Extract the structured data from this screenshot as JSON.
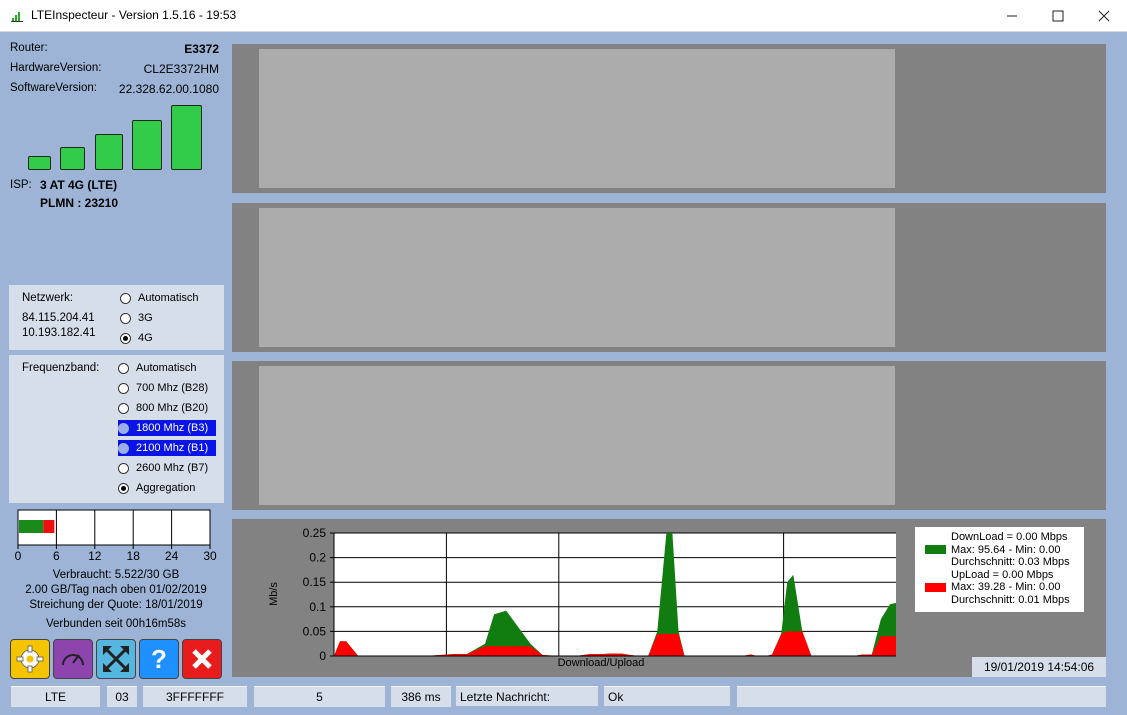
{
  "window": {
    "title": "LTEInspecteur - Version 1.5.16 - 19:53"
  },
  "device": {
    "router_label": "Router:",
    "router_value": "E3372",
    "hw_label": "HardwareVersion:",
    "hw_value": "CL2E3372HM",
    "sw_label": "SoftwareVersion:",
    "sw_value": "22.328.62.00.1080",
    "signal_bars": 5,
    "isp_label": "ISP:",
    "isp_value": "3 AT 4G (LTE)",
    "plmn": "PLMN : 23210"
  },
  "network": {
    "label": "Netzwerk:",
    "ip1": "84.115.204.41",
    "ip2": "10.193.182.41",
    "options": [
      {
        "label": "Automatisch",
        "checked": false
      },
      {
        "label": "3G",
        "checked": false
      },
      {
        "label": "4G",
        "checked": true
      }
    ]
  },
  "freq": {
    "label": "Frequenzband:",
    "options": [
      {
        "label": "Automatisch",
        "checked": false,
        "highlight": false
      },
      {
        "label": "700 Mhz (B28)",
        "checked": false,
        "highlight": false
      },
      {
        "label": "800 Mhz (B20)",
        "checked": false,
        "highlight": false
      },
      {
        "label": "1800 Mhz (B3)",
        "checked": false,
        "highlight": true
      },
      {
        "label": "2100 Mhz (B1)",
        "checked": false,
        "highlight": true
      },
      {
        "label": "2600 Mhz (B7)",
        "checked": false,
        "highlight": false
      },
      {
        "label": "Aggregation",
        "checked": true,
        "highlight": false
      }
    ]
  },
  "quota": {
    "axis_ticks": [
      "0",
      "6",
      "12",
      "18",
      "24",
      "30"
    ],
    "max": 30,
    "used": 5.522,
    "expected": 3.8,
    "used_color": "#1a8a1a",
    "over_color": "#ee1111",
    "used_text": "Verbraucht: 5.522/30 GB",
    "per_day_text": "2.00 GB/Tag nach oben 01/02/2019",
    "cut_text": "Streichung der Quote: 18/01/2019",
    "connected_text": "Verbunden seit 00h16m58s"
  },
  "tools": [
    {
      "name": "settings-gear-icon",
      "color": "#f5c400"
    },
    {
      "name": "speedometer-icon",
      "color": "#8e44ad"
    },
    {
      "name": "fullscreen-arrows-icon",
      "color": "#55b7e0"
    },
    {
      "name": "help-icon",
      "color": "#1e90ff"
    },
    {
      "name": "close-icon",
      "color": "#e81c1c"
    }
  ],
  "chart_data": {
    "type": "area",
    "ylabel": "Mb/s",
    "xlabel": "Download/Upload",
    "ylim": [
      0,
      0.25
    ],
    "yticks": [
      "0",
      "0.05",
      "0.1",
      "0.15",
      "0.2",
      "0.25"
    ],
    "x": [
      0,
      2,
      3,
      4,
      8,
      12,
      15,
      17,
      18,
      20,
      22,
      24,
      25,
      26,
      30,
      40,
      42,
      44,
      50,
      53,
      57,
      65,
      69,
      75,
      77,
      80,
      85,
      89,
      92,
      95,
      98,
      101,
      104,
      107,
      110,
      112,
      114,
      116,
      118,
      120,
      122,
      124,
      126,
      129,
      132,
      135,
      138,
      140,
      143,
      145,
      148,
      150,
      152,
      155,
      158,
      161,
      164,
      167,
      170,
      172,
      175,
      178,
      181,
      184,
      186
    ],
    "series": [
      {
        "name": "DownLoad",
        "color": "#117d11",
        "values": [
          0,
          0.03,
          0.03,
          0.03,
          0,
          0,
          0,
          0,
          0,
          0,
          0,
          0,
          0,
          0,
          0,
          0.004,
          0.004,
          0.004,
          0.025,
          0.085,
          0.092,
          0.025,
          0.002,
          0,
          0,
          0,
          0.004,
          0.004,
          0.005,
          0.005,
          0.002,
          0,
          0,
          0.05,
          0.25,
          0.25,
          0.05,
          0,
          0,
          0,
          0,
          0,
          0,
          0,
          0,
          0,
          0.003,
          0,
          0,
          0.003,
          0.045,
          0.15,
          0.165,
          0.05,
          0,
          0,
          0,
          0,
          0,
          0,
          0.003,
          0.003,
          0.075,
          0.105,
          0.108
        ]
      },
      {
        "name": "UpLoad",
        "color": "#ff0000",
        "values": [
          0,
          0.03,
          0.03,
          0.03,
          0,
          0,
          0,
          0,
          0,
          0,
          0,
          0,
          0,
          0,
          0,
          0.004,
          0.004,
          0.004,
          0.02,
          0.02,
          0.02,
          0.02,
          0.002,
          0,
          0,
          0,
          0.004,
          0.004,
          0.005,
          0.005,
          0.002,
          0,
          0,
          0.045,
          0.045,
          0.045,
          0.045,
          0,
          0,
          0,
          0,
          0,
          0,
          0,
          0,
          0,
          0.003,
          0,
          0,
          0.003,
          0.045,
          0.05,
          0.05,
          0.05,
          0,
          0,
          0,
          0,
          0,
          0,
          0.003,
          0.003,
          0.04,
          0.04,
          0.04
        ]
      }
    ]
  },
  "legend": {
    "dl_line1": "DownLoad = 0.00 Mbps",
    "dl_line2": "Max: 95.64 - Min: 0.00",
    "dl_line3": "Durchschnitt: 0.03 Mbps",
    "ul_line1": "UpLoad = 0.00 Mbps",
    "ul_line2": "Max: 39.28 - Min: 0.00",
    "ul_line3": "Durchschnitt: 0.01 Mbps"
  },
  "timestamp": "19/01/2019 14:54:06",
  "status": {
    "mode": "LTE",
    "code": "03",
    "hex": "3FFFFFFF",
    "num": "5",
    "ping": "386 ms",
    "msg_label": "Letzte Nachricht:",
    "msg": "Ok",
    "extra": ""
  }
}
